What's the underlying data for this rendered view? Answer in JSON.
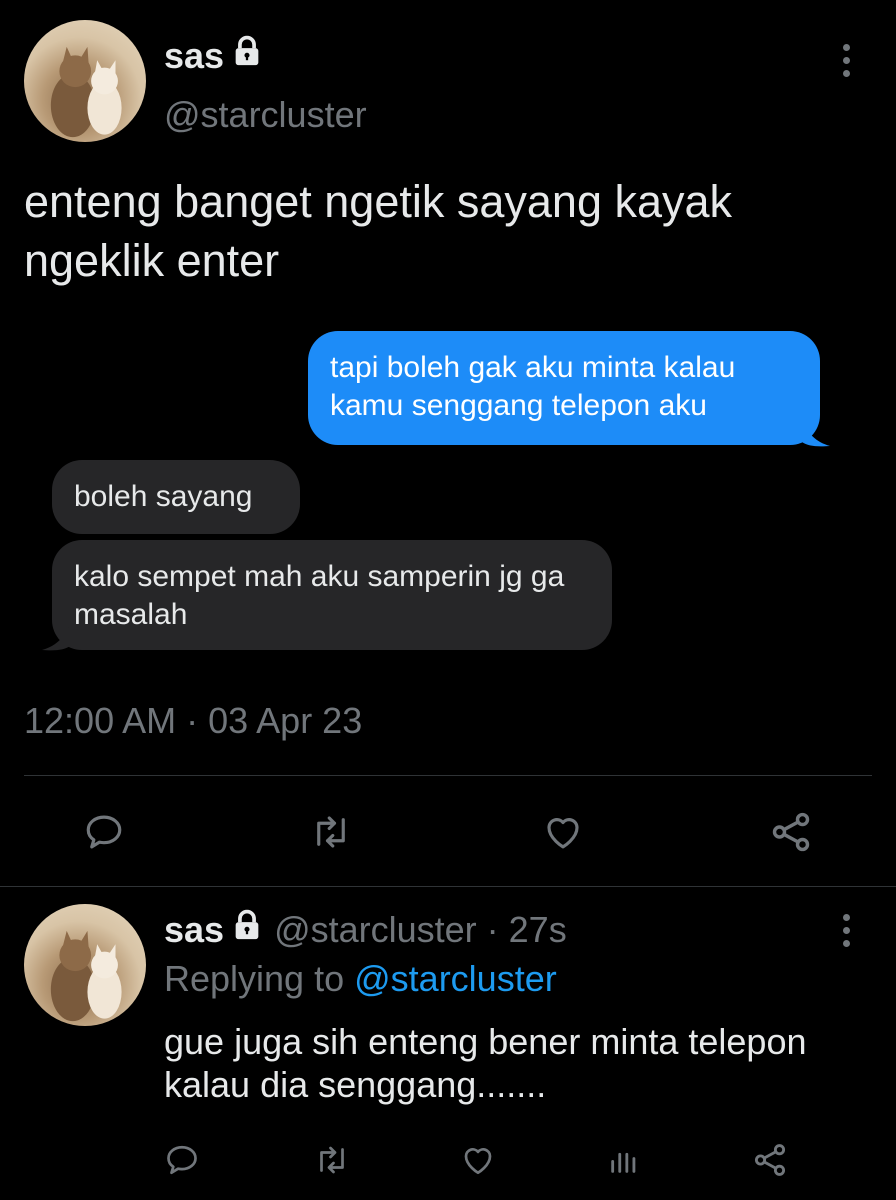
{
  "tweet": {
    "author_name": "sas",
    "author_handle": "@starcluster",
    "text": "enteng banget ngetik sayang kayak ngeklik enter",
    "timestamp": "12:00 AM · 03 Apr 23",
    "chat": {
      "outgoing": "tapi boleh gak aku minta kalau kamu senggang telepon aku",
      "incoming_1": "boleh sayang",
      "incoming_2": "kalo sempet mah aku samperin jg ga masalah"
    },
    "actions": [
      "reply-icon",
      "retweet-icon",
      "like-icon",
      "share-icon"
    ]
  },
  "reply": {
    "author_name": "sas",
    "author_handle": "@starcluster",
    "time_ago": "· 27s",
    "replying_prefix": "Replying to",
    "replying_to": "@starcluster",
    "text": "gue juga sih enteng bener minta telepon kalau dia senggang.......",
    "actions": [
      "reply-icon",
      "retweet-icon",
      "like-icon",
      "analytics-icon",
      "share-icon"
    ]
  },
  "colors": {
    "background": "#000000",
    "text": "#e7e9ea",
    "muted": "#71767b",
    "accent": "#1d9bf0",
    "bubble_out": "#1d8cf8",
    "bubble_in": "#262628"
  }
}
